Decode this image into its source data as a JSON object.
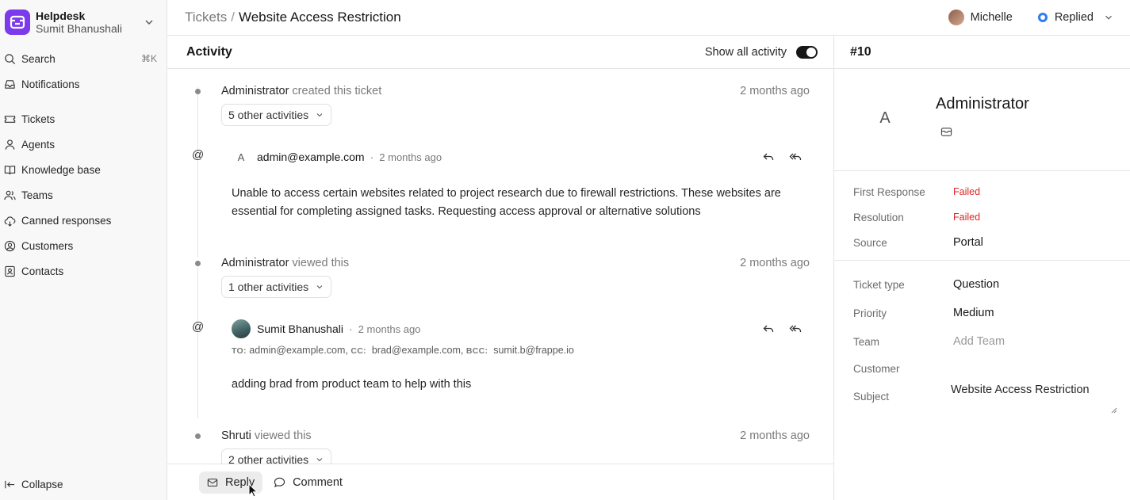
{
  "app": {
    "name": "Helpdesk",
    "user": "Sumit Bhanushali"
  },
  "sidebar": {
    "search_label": "Search",
    "search_shortcut": "⌘K",
    "notifications_label": "Notifications",
    "items": [
      {
        "label": "Tickets",
        "icon": "ticket-icon"
      },
      {
        "label": "Agents",
        "icon": "user-icon"
      },
      {
        "label": "Knowledge base",
        "icon": "book-icon"
      },
      {
        "label": "Teams",
        "icon": "users-icon"
      },
      {
        "label": "Canned responses",
        "icon": "cloud-icon"
      },
      {
        "label": "Customers",
        "icon": "user-circle-icon"
      },
      {
        "label": "Contacts",
        "icon": "contact-icon"
      }
    ],
    "collapse_label": "Collapse"
  },
  "header": {
    "breadcrumb_root": "Tickets",
    "breadcrumb_sep": "/",
    "breadcrumb_current": "Website Access Restriction",
    "assignee": "Michelle",
    "status": "Replied",
    "status_color": "#2f7cf6"
  },
  "activity": {
    "title": "Activity",
    "show_all_label": "Show all activity",
    "show_all_enabled": true,
    "entries": [
      {
        "who": "Administrator",
        "what": "created this ticket",
        "when": "2 months ago",
        "more": "5 other activities"
      },
      {
        "who": "Administrator",
        "what": "viewed this",
        "when": "2 months ago",
        "more": "1 other activities"
      },
      {
        "who": "Shruti",
        "what": "viewed this",
        "when": "2 months ago",
        "more": "2 other activities"
      }
    ],
    "emails": [
      {
        "avatar_letter": "A",
        "from": "admin@example.com",
        "when": "2 months ago",
        "body": "Unable to access certain websites related to project research due to firewall restrictions. These websites are essential for completing assigned tasks. Requesting access approval or alternative solutions"
      },
      {
        "from": "Sumit Bhanushali",
        "when": "2 months ago",
        "to_label": "TO:",
        "to": "admin@example.com,",
        "cc_label": "CC:",
        "cc": "brad@example.com,",
        "bcc_label": "BCC:",
        "bcc": "sumit.b@frappe.io",
        "body": "adding brad from product team to help with this"
      }
    ],
    "composer": {
      "reply_label": "Reply",
      "comment_label": "Comment"
    }
  },
  "details": {
    "ticket_id": "#10",
    "contact": {
      "avatar_letter": "A",
      "name": "Administrator"
    },
    "sla": [
      {
        "label": "First Response",
        "value": "Failed"
      },
      {
        "label": "Resolution",
        "value": "Failed"
      },
      {
        "label": "Source",
        "value": "Portal"
      }
    ],
    "fields": {
      "ticket_type_label": "Ticket type",
      "ticket_type": "Question",
      "priority_label": "Priority",
      "priority": "Medium",
      "team_label": "Team",
      "team_placeholder": "Add Team",
      "customer_label": "Customer",
      "customer": "",
      "subject_label": "Subject",
      "subject": "Website Access Restriction"
    },
    "failed_color": "#dc2626"
  }
}
